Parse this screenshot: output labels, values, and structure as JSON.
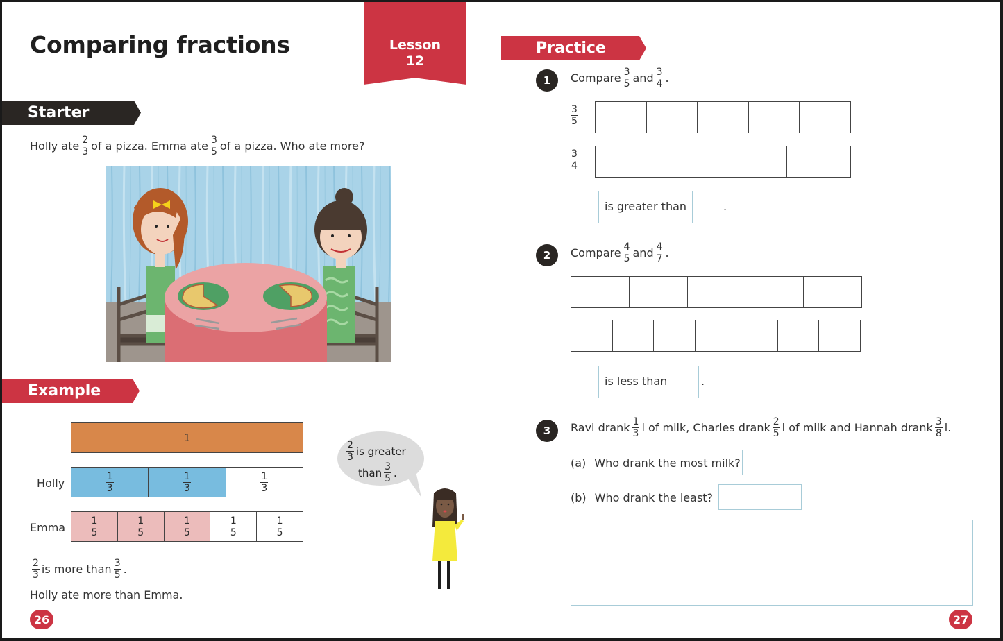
{
  "left_page": {
    "title": "Comparing fractions",
    "lesson_banner": {
      "label": "Lesson",
      "number": "12"
    },
    "starter": {
      "tag": "Starter",
      "question": {
        "part1": "Holly ate",
        "frac1": {
          "n": "2",
          "d": "3"
        },
        "part2": "of a pizza. Emma ate",
        "frac2": {
          "n": "3",
          "d": "5"
        },
        "part3": "of a pizza. Who ate more?"
      },
      "illustration": "two-girls-at-table-with-pizzas"
    },
    "example": {
      "tag": "Example",
      "whole_bar_label": "1",
      "rows": [
        {
          "label": "Holly",
          "cells": [
            {
              "n": "1",
              "d": "3",
              "shaded": true
            },
            {
              "n": "1",
              "d": "3",
              "shaded": true
            },
            {
              "n": "1",
              "d": "3",
              "shaded": false
            }
          ]
        },
        {
          "label": "Emma",
          "cells": [
            {
              "n": "1",
              "d": "5",
              "shaded": true
            },
            {
              "n": "1",
              "d": "5",
              "shaded": true
            },
            {
              "n": "1",
              "d": "5",
              "shaded": true
            },
            {
              "n": "1",
              "d": "5",
              "shaded": false
            },
            {
              "n": "1",
              "d": "5",
              "shaded": false
            }
          ]
        }
      ],
      "speech_bubble": {
        "frac1": {
          "n": "2",
          "d": "3"
        },
        "text1": "is greater",
        "text2": "than",
        "frac2": {
          "n": "3",
          "d": "5"
        },
        "end": "."
      },
      "conclusion": {
        "frac1": {
          "n": "2",
          "d": "3"
        },
        "text": "is more than",
        "frac2": {
          "n": "3",
          "d": "5"
        },
        "end": ".",
        "line2": "Holly ate more than Emma."
      }
    },
    "page_number": "26"
  },
  "right_page": {
    "practice_tag": "Practice",
    "questions": [
      {
        "number": "1",
        "prompt": "Compare",
        "frac1": {
          "n": "3",
          "d": "5"
        },
        "and": "and",
        "frac2": {
          "n": "3",
          "d": "4"
        },
        "end": ".",
        "bars": [
          {
            "label": {
              "n": "3",
              "d": "5"
            },
            "parts": 5
          },
          {
            "label": {
              "n": "3",
              "d": "4"
            },
            "parts": 4
          }
        ],
        "answer_sentence": "is greater than",
        "answer_end": "."
      },
      {
        "number": "2",
        "prompt": "Compare",
        "frac1": {
          "n": "4",
          "d": "5"
        },
        "and": "and",
        "frac2": {
          "n": "4",
          "d": "7"
        },
        "end": ".",
        "bars": [
          {
            "parts": 5
          },
          {
            "parts": 7
          }
        ],
        "answer_sentence": "is less than",
        "answer_end": "."
      },
      {
        "number": "3",
        "text1": "Ravi drank",
        "frac1": {
          "n": "1",
          "d": "3"
        },
        "text2": "l of milk, Charles drank",
        "frac2": {
          "n": "2",
          "d": "5"
        },
        "text3": "l of milk and Hannah drank",
        "frac3": {
          "n": "3",
          "d": "8"
        },
        "text4": "l.",
        "sub": [
          {
            "label": "(a)",
            "text": "Who drank the most milk?"
          },
          {
            "label": "(b)",
            "text": "Who drank the least?"
          }
        ]
      }
    ],
    "page_number": "27"
  },
  "colors": {
    "brand_red": "#cc3443",
    "dark_tag": "#2a2623",
    "holly_blue": "#78bcdf",
    "emma_pink": "#ecbcbb",
    "whole_orange": "#d8874a",
    "answer_box_border": "#a8ccd8"
  }
}
